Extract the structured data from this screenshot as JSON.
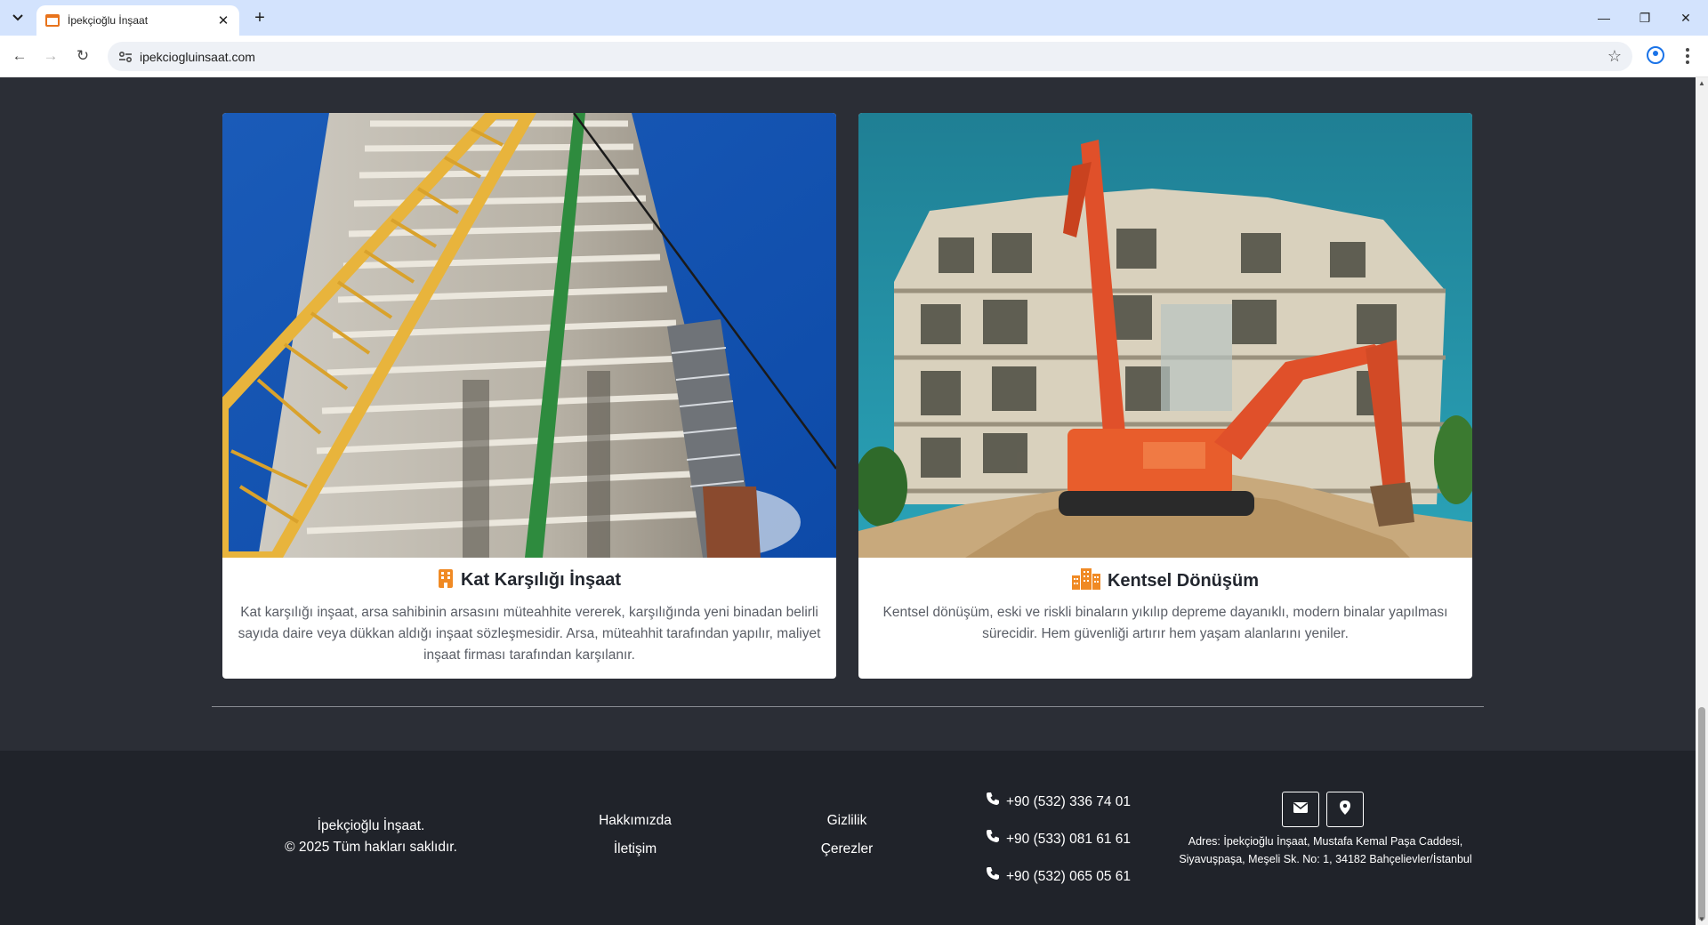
{
  "browser": {
    "tab_title": "İpekçioğlu İnşaat",
    "url": "ipekciogluinsaat.com"
  },
  "services": [
    {
      "title": "Kat Karşılığı İnşaat",
      "description": "Kat karşılığı inşaat, arsa sahibinin arsasını müteahhite vererek, karşılığında yeni binadan belirli sayıda daire veya dükkan aldığı inşaat sözleşmesidir. Arsa, müteahhit tarafından yapılır, maliyet inşaat firması tarafından karşılanır.",
      "icon": "building-icon"
    },
    {
      "title": "Kentsel Dönüşüm",
      "description": "Kentsel dönüşüm, eski ve riskli binaların yıkılıp depreme dayanıklı, modern binalar yapılması sürecidir. Hem güvenliği artırır hem yaşam alanlarını yeniler.",
      "icon": "city-icon"
    }
  ],
  "footer": {
    "brand_line1": "İpekçioğlu İnşaat.",
    "brand_line2": "© 2025 Tüm hakları saklıdır.",
    "links_col1": [
      "Hakkımızda",
      "İletişim"
    ],
    "links_col2": [
      "Gizlilik",
      "Çerezler"
    ],
    "phones": [
      "+90 (532) 336 74 01",
      "+90 (533) 081 61 61",
      "+90 (532) 065 05 61"
    ],
    "address_line1": "Adres: İpekçioğlu İnşaat, Mustafa Kemal Paşa Caddesi,",
    "address_line2": "Siyavuşpaşa, Meşeli Sk. No: 1, 34182 Bahçelievler/İstanbul"
  },
  "colors": {
    "accent": "#f08a24",
    "page_bg": "#2b2e36",
    "footer_bg": "#20232a"
  }
}
